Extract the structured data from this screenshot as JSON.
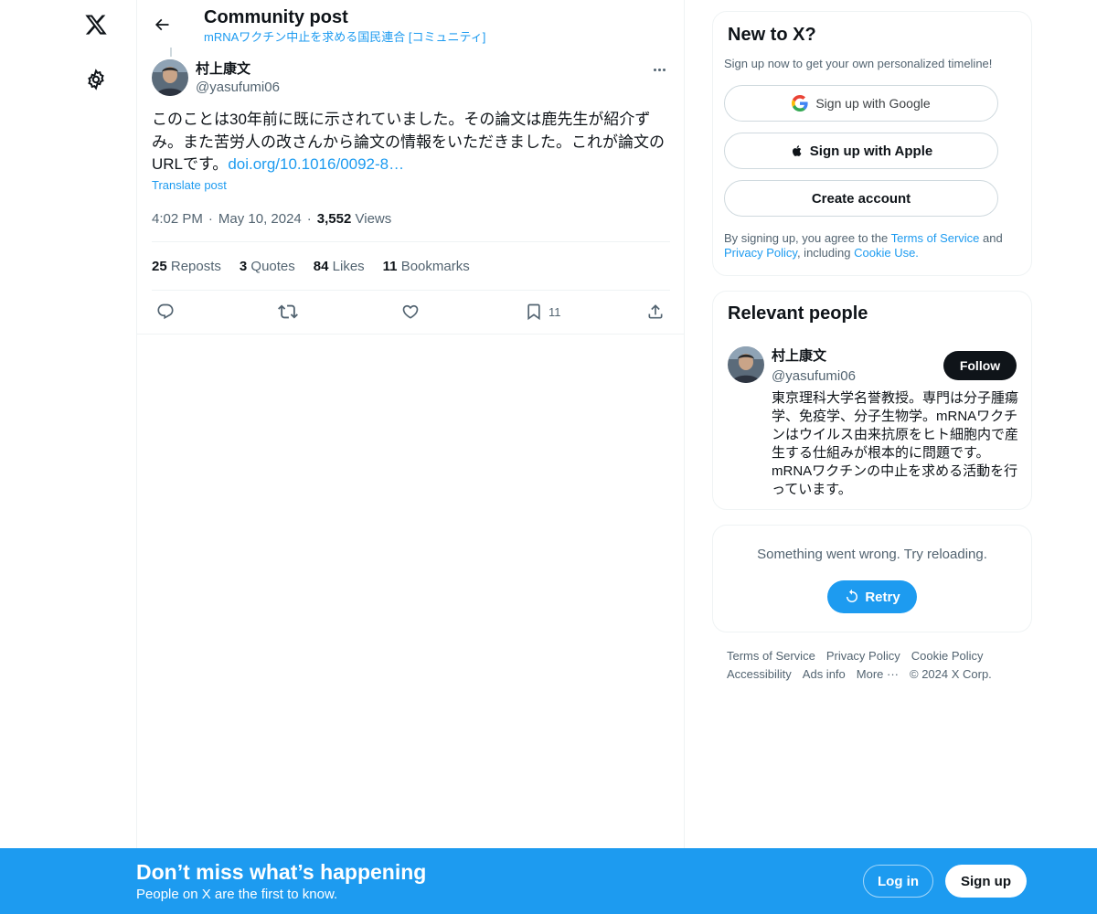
{
  "header": {
    "title": "Community post",
    "community": "mRNAワクチン中止を求める国民連合 [コミュニティ]"
  },
  "post": {
    "author_name": "村上康文",
    "author_handle": "@yasufumi06",
    "text": "このことは30年前に既に示されていました。その論文は鹿先生が紹介ずみ。また苦労人の改さんから論文の情報をいただきました。これが論文のURLです。",
    "link": "doi.org/10.1016/0092-8…",
    "translate_label": "Translate post",
    "time": "4:02 PM",
    "date": "May 10, 2024",
    "views_count": "3,552",
    "views_label": "Views",
    "stats": {
      "reposts_count": "25",
      "reposts_label": "Reposts",
      "quotes_count": "3",
      "quotes_label": "Quotes",
      "likes_count": "84",
      "likes_label": "Likes",
      "bookmarks_count": "11",
      "bookmarks_label": "Bookmarks"
    },
    "bookmark_action_count": "11"
  },
  "signup_card": {
    "title": "New to X?",
    "subtitle": "Sign up now to get your own personalized timeline!",
    "google_label": "Sign up with Google",
    "apple_label": "Sign up with Apple",
    "create_label": "Create account",
    "legal_prefix": "By signing up, you agree to the ",
    "terms_label": "Terms of Service",
    "legal_and": " and ",
    "privacy_label": "Privacy Policy",
    "legal_including": ", including ",
    "cookie_label": "Cookie Use."
  },
  "relevant_people": {
    "title": "Relevant people",
    "name": "村上康文",
    "handle": "@yasufumi06",
    "follow_label": "Follow",
    "bio": "東京理科大学名誉教授。専門は分子腫瘍学、免疫学、分子生物学。mRNAワクチンはウイルス由来抗原をヒト細胞内で産生する仕組みが根本的に問題です。mRNAワクチンの中止を求める活動を行っています。"
  },
  "error_card": {
    "message": "Something went wrong. Try reloading.",
    "retry_label": "Retry"
  },
  "footer": {
    "terms": "Terms of Service",
    "privacy": "Privacy Policy",
    "cookie": "Cookie Policy",
    "accessibility": "Accessibility",
    "ads": "Ads info",
    "more": "More ···",
    "copyright": "© 2024 X Corp."
  },
  "banner": {
    "title": "Don’t miss what’s happening",
    "subtitle": "People on X are the first to know.",
    "login_label": "Log in",
    "signup_label": "Sign up"
  },
  "colors": {
    "accent": "#1d9bf0",
    "text": "#0f1419",
    "muted": "#536471",
    "border": "#eff3f4"
  },
  "icons": {
    "logo": "x-logo-icon",
    "settings": "gear-icon",
    "back": "arrow-left-icon",
    "more": "more-dots-icon",
    "reply": "reply-icon",
    "repost": "repost-icon",
    "like": "heart-icon",
    "bookmark": "bookmark-icon",
    "share": "share-icon",
    "google": "google-icon",
    "apple": "apple-icon",
    "retry": "refresh-icon"
  }
}
